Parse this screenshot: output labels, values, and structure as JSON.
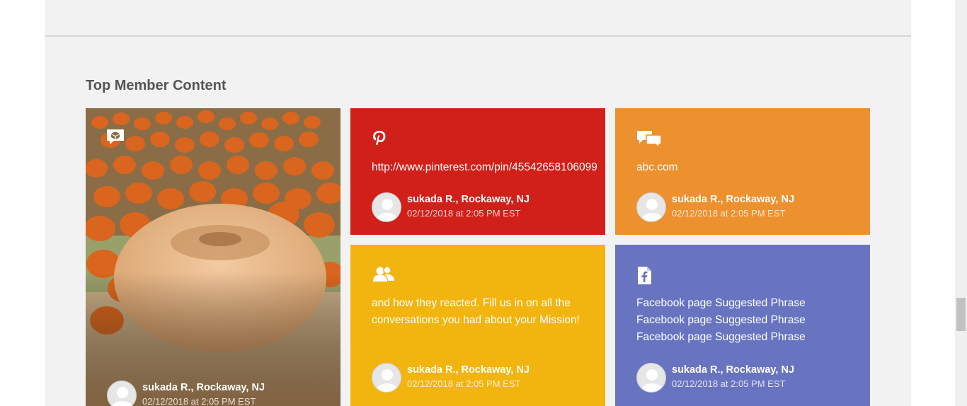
{
  "section": {
    "title": "Top Member Content"
  },
  "tiles": [
    {
      "type": "photo",
      "icon": "cube-chat-icon",
      "text": "",
      "author": "sukada R., Rockaway, NJ",
      "date": "02/12/2018 at 2:05 PM EST",
      "photo_subject": "pumpkin patch with large pale pumpkin"
    },
    {
      "type": "pinterest",
      "icon": "pinterest-icon",
      "text": "http://www.pinterest.com/pin/45542658106099",
      "author": "sukada R., Rockaway, NJ",
      "date": "02/12/2018 at 2:05 PM EST",
      "color": "#d11f1a"
    },
    {
      "type": "comment",
      "icon": "speech-bubbles-icon",
      "text": "abc.com",
      "author": "sukada R., Rockaway, NJ",
      "date": "02/12/2018 at 2:05 PM EST",
      "color": "#ed902e"
    },
    {
      "type": "group",
      "icon": "people-icon",
      "text": "and how they reacted. Fill us in on all the conversations you had about your Mission!",
      "author": "sukada R., Rockaway, NJ",
      "date": "02/12/2018 at 2:05 PM EST",
      "color": "#f2b40e"
    },
    {
      "type": "facebook",
      "icon": "facebook-page-icon",
      "text_lines": [
        "Facebook page Suggested Phrase",
        "Facebook page Suggested Phrase",
        "Facebook page Suggested Phrase"
      ],
      "author": "sukada R., Rockaway, NJ",
      "date": "02/12/2018 at 2:05 PM EST",
      "color": "#6874c0"
    }
  ]
}
